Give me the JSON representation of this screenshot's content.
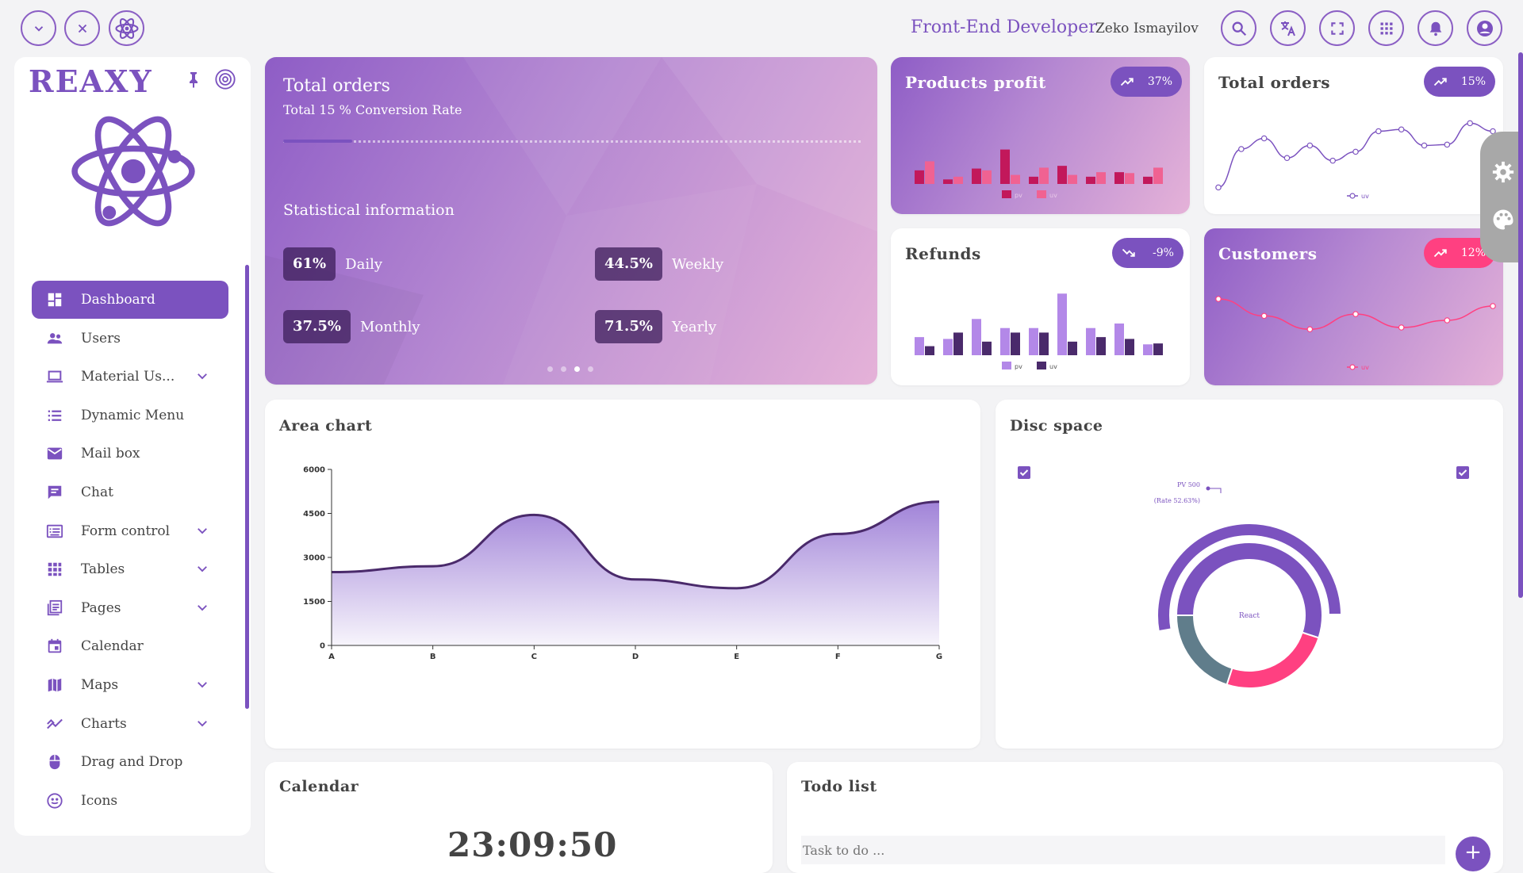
{
  "header": {
    "title": "Front-End Developer",
    "user_name": "Zeko Ismayilov",
    "left_icons": [
      "chevron-down-icon",
      "close-icon",
      "atom-icon"
    ],
    "right_icons": [
      "search-icon",
      "translate-icon",
      "fullscreen-icon",
      "apps-icon",
      "bell-icon",
      "account-icon"
    ]
  },
  "sidebar": {
    "brand": "REAXY",
    "items": [
      {
        "label": "Dashboard",
        "icon": "dashboard-icon",
        "active": true,
        "expandable": false
      },
      {
        "label": "Users",
        "icon": "users-icon",
        "active": false,
        "expandable": false
      },
      {
        "label": "Material Us...",
        "icon": "laptop-icon",
        "active": false,
        "expandable": true
      },
      {
        "label": "Dynamic Menu",
        "icon": "list-icon",
        "active": false,
        "expandable": false
      },
      {
        "label": "Mail box",
        "icon": "mail-icon",
        "active": false,
        "expandable": false
      },
      {
        "label": "Chat",
        "icon": "chat-icon",
        "active": false,
        "expandable": false
      },
      {
        "label": "Form control",
        "icon": "form-icon",
        "active": false,
        "expandable": true
      },
      {
        "label": "Tables",
        "icon": "grid-icon",
        "active": false,
        "expandable": true
      },
      {
        "label": "Pages",
        "icon": "pages-icon",
        "active": false,
        "expandable": true
      },
      {
        "label": "Calendar",
        "icon": "calendar-icon",
        "active": false,
        "expandable": false
      },
      {
        "label": "Maps",
        "icon": "map-icon",
        "active": false,
        "expandable": true
      },
      {
        "label": "Charts",
        "icon": "chart-icon",
        "active": false,
        "expandable": true
      },
      {
        "label": "Drag and Drop",
        "icon": "mouse-icon",
        "active": false,
        "expandable": false
      },
      {
        "label": "Icons",
        "icon": "smile-icon",
        "active": false,
        "expandable": false
      }
    ]
  },
  "hero": {
    "title": "Total orders",
    "subtitle": "Total 15 % Conversion Rate",
    "progress": 0.15,
    "stats_title": "Statistical information",
    "stats": [
      {
        "value": "61%",
        "label": "Daily"
      },
      {
        "value": "44.5%",
        "label": "Weekly"
      },
      {
        "value": "37.5%",
        "label": "Monthly"
      },
      {
        "value": "71.5%",
        "label": "Yearly"
      }
    ],
    "carousel_active": 2,
    "carousel_count": 4
  },
  "mini_cards": {
    "products_profit": {
      "title": "Products profit",
      "badge": "37%",
      "legend": [
        "pv",
        "uv"
      ],
      "colors": [
        "#c2185b",
        "#f06292"
      ]
    },
    "total_orders": {
      "title": "Total orders",
      "badge": "15%",
      "legend": [
        "uv"
      ],
      "color": "#7b52bf"
    },
    "refunds": {
      "title": "Refunds",
      "badge": "-9%",
      "legend": [
        "pv",
        "uv"
      ],
      "colors": [
        "#b388e8",
        "#4a2a6b"
      ]
    },
    "customers": {
      "title": "Customers",
      "badge": "12%",
      "legend": [
        "uv"
      ],
      "color": "#ff4081"
    }
  },
  "area_card": {
    "title": "Area chart"
  },
  "disc_card": {
    "title": "Disc space",
    "center_label": "React",
    "annotation_line1": "PV 500",
    "annotation_line2": "(Rate 52.63%)"
  },
  "calendar_card": {
    "title": "Calendar",
    "time": "23:09:50"
  },
  "todo_card": {
    "title": "Todo list",
    "placeholder": "Task to do ...",
    "add_label": "+"
  },
  "colors": {
    "accent": "#7b52bf",
    "pink": "#ff4081",
    "dark": "#4a2a6b"
  },
  "chart_data": [
    {
      "type": "area",
      "title": "Area chart",
      "categories": [
        "A",
        "B",
        "C",
        "D",
        "E",
        "F",
        "G"
      ],
      "series": [
        {
          "values": [
            2500,
            2700,
            4450,
            2250,
            1950,
            3800,
            4900
          ]
        }
      ],
      "ylim": [
        0,
        6000
      ],
      "yticks": [
        0,
        1500,
        3000,
        4500,
        6000
      ],
      "grid": false
    },
    {
      "type": "bar",
      "title": "Products profit",
      "series": [
        {
          "name": "pv",
          "values": [
            15,
            5,
            17,
            38,
            8,
            20,
            8,
            13,
            8
          ]
        },
        {
          "name": "uv",
          "values": [
            25,
            8,
            15,
            10,
            18,
            10,
            13,
            12,
            18
          ]
        }
      ]
    },
    {
      "type": "line",
      "title": "Total orders",
      "series": [
        {
          "name": "uv",
          "values": [
            5,
            48,
            60,
            38,
            52,
            35,
            45,
            68,
            70,
            52,
            53,
            77,
            68
          ]
        }
      ]
    },
    {
      "type": "bar",
      "title": "Refunds",
      "series": [
        {
          "name": "pv",
          "values": [
            20,
            18,
            40,
            30,
            30,
            68,
            30,
            35,
            12
          ]
        },
        {
          "name": "uv",
          "values": [
            10,
            25,
            15,
            25,
            25,
            15,
            20,
            18,
            13
          ]
        }
      ]
    },
    {
      "type": "line",
      "title": "Customers",
      "series": [
        {
          "name": "uv",
          "values": [
            72,
            53,
            38,
            55,
            40,
            48,
            64
          ]
        }
      ]
    },
    {
      "type": "pie",
      "title": "Disc space",
      "series": [
        {
          "name": "inner",
          "values": [
            100
          ]
        },
        {
          "name": "middle",
          "values": [
            55,
            25,
            20
          ]
        },
        {
          "name": "outer",
          "values": [
            500,
            150,
            300
          ]
        }
      ]
    }
  ]
}
